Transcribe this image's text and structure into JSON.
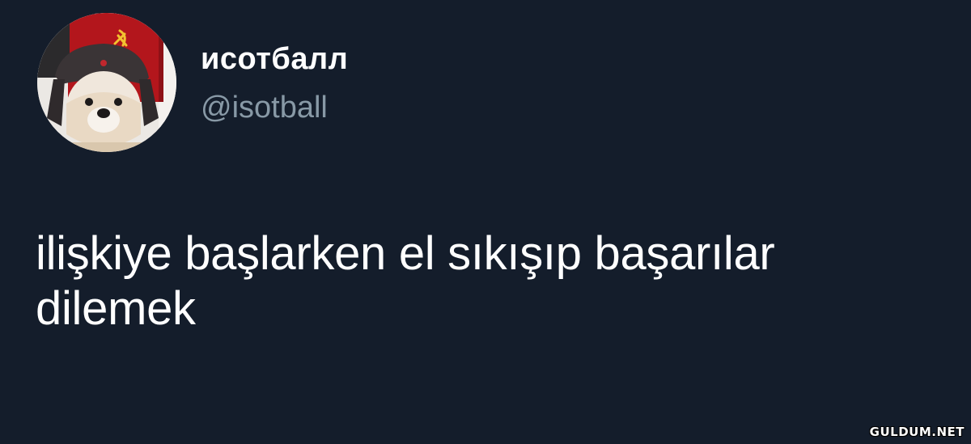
{
  "user": {
    "display_name": "исотбалл",
    "handle": "@isotball",
    "avatar_icon": "dog-in-ushanka-avatar"
  },
  "tweet": {
    "lines": [
      "ilişkiye başlarken el sıkışıp başarılar",
      "dilemek"
    ]
  },
  "watermark": "GULDUM.NET",
  "colors": {
    "background": "#141d2b",
    "text": "#ffffff",
    "handle": "#8899a6",
    "flag_red": "#b3161c"
  }
}
